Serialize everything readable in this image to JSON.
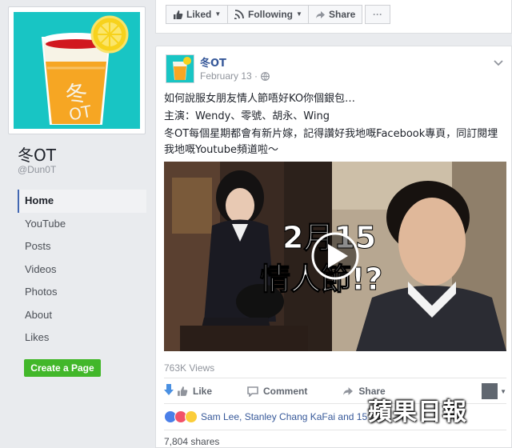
{
  "page": {
    "name": "冬OT",
    "handle": "@Dun0T"
  },
  "nav": {
    "items": [
      {
        "label": "Home",
        "active": true
      },
      {
        "label": "YouTube"
      },
      {
        "label": "Posts"
      },
      {
        "label": "Videos"
      },
      {
        "label": "Photos"
      },
      {
        "label": "About"
      },
      {
        "label": "Likes"
      }
    ],
    "create_page": "Create a Page"
  },
  "topbar": {
    "liked": "Liked",
    "following": "Following",
    "share": "Share",
    "more": "···"
  },
  "post": {
    "author": "冬OT",
    "date": "February 13 ·",
    "lines": [
      "如何說服女朋友情人節唔好KO你個銀包…",
      "主演：Wendy、零號、胡永、Wing",
      "冬OT每個星期都會有新片嫁，記得讚好我地嘅Facebook專頁，同訂閱埋我地嘅Youtube頻道啦～"
    ],
    "video_overlay": [
      "2月15",
      "情人節!?"
    ],
    "views": "763K Views",
    "actions": {
      "like": "Like",
      "comment": "Comment",
      "share": "Share"
    },
    "reactions_text": "Sam Lee, Stanley Chang KaFai and 15",
    "shares": "7,804 shares"
  },
  "watermark": "蘋果日報",
  "colors": {
    "brand_blue": "#4267b2",
    "link_blue": "#365899",
    "create_green": "#42b72a",
    "avatar_teal": "#18c5c4"
  }
}
